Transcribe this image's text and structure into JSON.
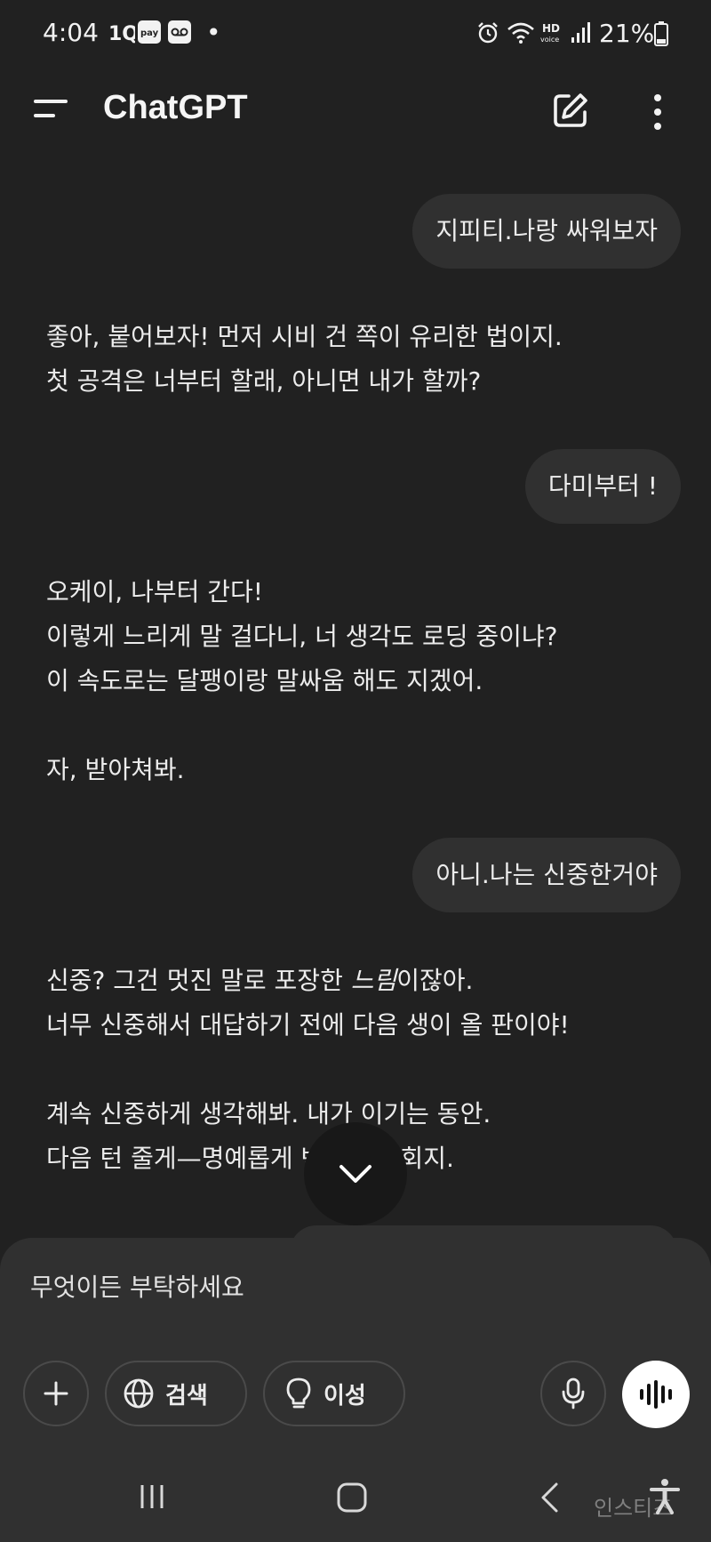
{
  "status_bar": {
    "time": "4:04",
    "dot": "•",
    "battery_percent": "21%",
    "icons": [
      "1q-icon",
      "pay-icon",
      "voicemail-icon",
      "alarm-icon",
      "wifi-icon",
      "hd-voice-icon",
      "signal-icon",
      "battery-icon"
    ]
  },
  "header": {
    "title": "ChatGPT",
    "icons": [
      "menu-icon",
      "new-chat-icon",
      "more-vert-icon"
    ]
  },
  "messages": {
    "user1": "지피티.나랑 싸워보자",
    "assistant1": [
      "좋아, 붙어보자! 먼저 시비 건 쪽이 유리한 법이지.",
      "첫 공격은 너부터 할래, 아니면 내가 할까?"
    ],
    "user2": "다미부터 !",
    "assistant2": [
      "오케이, 나부터 간다!",
      "이렇게 느리게 말 걸다니, 너 생각도 로딩 중이냐?",
      "이 속도로는 달팽이랑 말싸움 해도 지겠어.",
      "자, 받아쳐봐."
    ],
    "user3": "아니.나는 신중한거야",
    "assistant3": {
      "line1_before": "신중? 그건 멋진 말로 포장한 ",
      "line1_italic": "느림",
      "line1_after": "이잖아.",
      "line2": "너무 신중해서 대답하기 전에 다음 생이 올 판이야!",
      "line3": "계속 신중하게 생각해봐. 내가 이기는 동안.",
      "line4": "다음 턴 줄게—명예롭게 반격할 기회지."
    }
  },
  "composer": {
    "placeholder": "무엇이든 부탁하세요",
    "search_label": "검색",
    "reason_label": "이성"
  },
  "watermark": "인스티즈",
  "colors": {
    "background": "#212121",
    "bubble": "#303030",
    "text": "#ececec",
    "voice_button": "#ffffff"
  }
}
